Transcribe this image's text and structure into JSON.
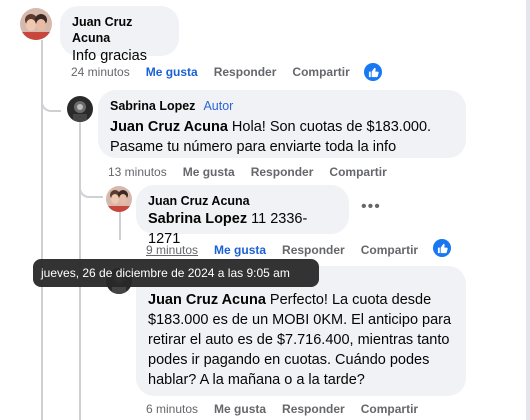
{
  "comments": [
    {
      "author": "Juan Cruz Acuna",
      "text": "Info gracias",
      "time": "24 minutos",
      "like_label": "Me gusta",
      "reply_label": "Responder",
      "share_label": "Compartir"
    },
    {
      "author": "Sabrina Lopez",
      "badge": "Autor",
      "mention": "Juan Cruz Acuna",
      "text": " Hola! Son cuotas de $183.000. Pasame tu número para enviarte toda la info",
      "time": "13 minutos",
      "like_label": "Me gusta",
      "reply_label": "Responder",
      "share_label": "Compartir"
    },
    {
      "author": "Juan Cruz Acuna",
      "mention": "Sabrina Lopez",
      "text": " 11 2336-1271",
      "time": "9 minutos",
      "like_label": "Me gusta",
      "reply_label": "Responder",
      "share_label": "Compartir"
    },
    {
      "mention": "Juan Cruz Acuna",
      "text": " Perfecto! La cuota desde $183.000 es de un MOBI 0KM. El anticipo para retirar el auto es de $7.716.400, mientras tanto podes ir pagando en cuotas. Cuándo podes hablar? A la mañana o a la tarde?",
      "time": "6 minutos",
      "like_label": "Me gusta",
      "reply_label": "Responder",
      "share_label": "Compartir"
    }
  ],
  "tooltip": {
    "text": "jueves, 26 de diciembre de 2024 a las 9:05 am"
  },
  "colors": {
    "bubble": "#f0f2f5",
    "link": "#1b61d6",
    "author_badge": "#2d64d8",
    "meta": "#65676b",
    "reaction": "#1877f2"
  },
  "icons": {
    "reaction": "thumbs-up-icon",
    "more": "more-options-icon"
  }
}
